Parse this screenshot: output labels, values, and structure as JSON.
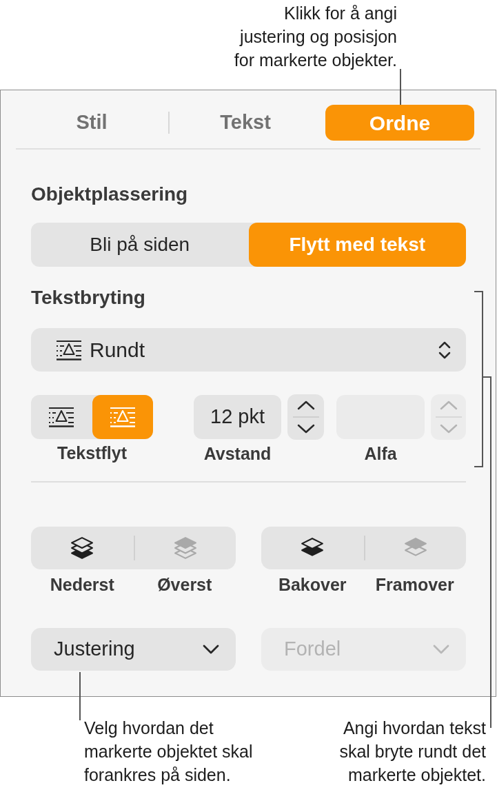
{
  "callouts": {
    "top": "Klikk for å angi\njustering og posisjon\nfor markerte objekter.",
    "bottom_left": "Velg hvordan det\nmarkerte objektet skal\nforankres på siden.",
    "bottom_right": "Angi hvordan tekst\nskal bryte rundt det\nmarkerte objektet."
  },
  "tabs": [
    {
      "label": "Stil",
      "selected": false
    },
    {
      "label": "Tekst",
      "selected": false
    },
    {
      "label": "Ordne",
      "selected": true
    }
  ],
  "object_placement": {
    "heading": "Objektplassering",
    "options": [
      {
        "label": "Bli på siden",
        "selected": false
      },
      {
        "label": "Flytt med tekst",
        "selected": true
      }
    ]
  },
  "text_wrap": {
    "heading": "Tekstbryting",
    "wrap_select": {
      "value": "Rundt"
    },
    "text_fit": {
      "label": "Tekstflyt",
      "options": [
        {
          "selected": false
        },
        {
          "selected": true
        }
      ]
    },
    "spacing": {
      "label": "Avstand",
      "value": "12 pkt",
      "disabled": false
    },
    "alpha": {
      "label": "Alfa",
      "disabled": true
    }
  },
  "layer_groups": [
    {
      "buttons": [
        {
          "kind": "bottom",
          "label": "Nederst",
          "disabled": false
        },
        {
          "kind": "top",
          "label": "Øverst",
          "disabled": true
        }
      ]
    },
    {
      "buttons": [
        {
          "kind": "backward",
          "label": "Bakover",
          "disabled": false
        },
        {
          "kind": "forward",
          "label": "Framover",
          "disabled": true
        }
      ]
    }
  ],
  "dropdowns": [
    {
      "value": "Justering",
      "disabled": false
    },
    {
      "value": "Fordel",
      "disabled": true
    }
  ]
}
